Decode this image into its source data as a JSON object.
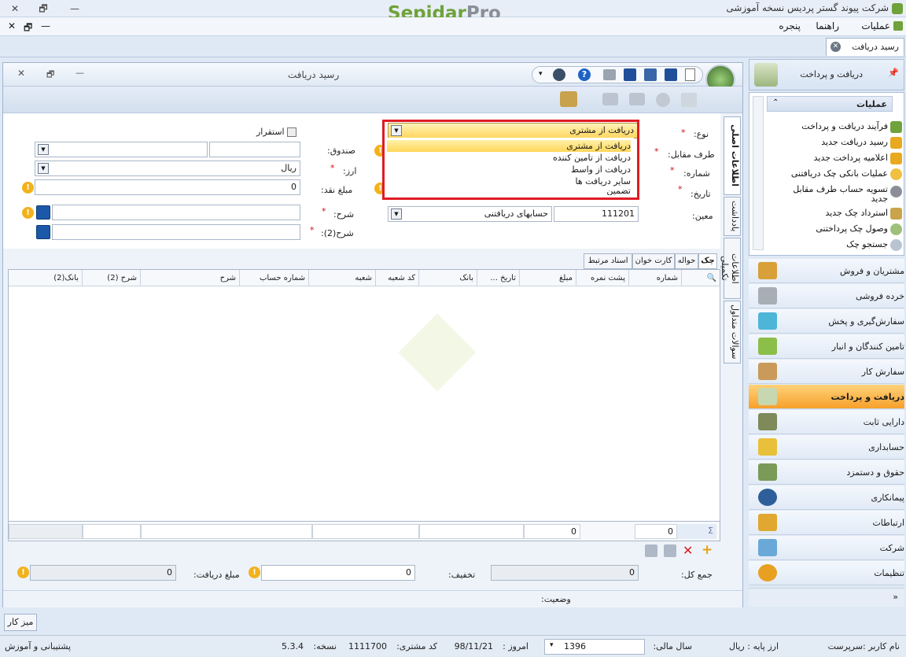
{
  "app": {
    "title": "شرکت پیوند گستر پردیس نسخه آموزشی",
    "logo_main": "Sepidar",
    "logo_accent": "Pro",
    "menu": [
      "عملیات",
      "راهنما",
      "پنجره"
    ]
  },
  "doc_tab": {
    "label": "رسید دریافت"
  },
  "window": {
    "title": "رسید دریافت"
  },
  "form": {
    "type_label": "نوع:",
    "type_value": "دریافت از مشتری",
    "type_options": [
      "دریافت از مشتری",
      "دریافت از تامین کننده",
      "دریافت از واسط",
      "سایر دریافت ها",
      "تضمین"
    ],
    "counterparty_label": "طرف مقابل:",
    "number_label": "شماره:",
    "date_label": "تاریخ:",
    "ledger_label": "معین:",
    "ledger_code": "111201",
    "ledger_name": "حسابهای دریافتنی",
    "settle_label": "استقرار",
    "cashbox_label": "صندوق:",
    "currency_label": "ارز:",
    "currency_value": "ریال",
    "cash_label": "مبلغ نقد:",
    "cash_value": "0",
    "desc_label": "شرح:",
    "desc2_label": "شرح(2):"
  },
  "vtabs": [
    "اطلاعات اصلی",
    "یادداشت",
    "اطلاعات تکمیلی",
    "سوالات متداول"
  ],
  "grid_tabs": [
    "چک",
    "حواله",
    "کارت خوان",
    "اسناد مرتبط"
  ],
  "grid_headers": [
    "شماره",
    "پشت نمره",
    "مبلغ",
    "تاریخ ...",
    "بانک",
    "کد شعبه",
    "شعبه",
    "شماره حساب",
    "شرح",
    "شرح (2)",
    "بانک(2)"
  ],
  "grid_footer": {
    "count": "0",
    "sum": "0"
  },
  "totals": {
    "total_label": "جمع کل:",
    "total_value": "0",
    "discount_label": "تخفیف:",
    "discount_value": "0",
    "received_label": "مبلغ دریافت:",
    "received_value": "0"
  },
  "status": {
    "label": "وضعیت:"
  },
  "right_panel": {
    "title": "دریافت و پرداخت",
    "ops_title": "عملیات",
    "ops": [
      "فرآیند دریافت و پرداخت",
      "رسید دریافت جدید",
      "اعلامیه پرداخت جدید",
      "عملیات بانکی چک دریافتنی",
      "تسویه حساب طرف مقابل",
      "جدید",
      "استرداد چک جدید",
      "وصول چک پرداختنی",
      "جستجو چک"
    ],
    "modules": [
      "مشتریان و فروش",
      "خرده فروشی",
      "سفارش‌گیری و پخش",
      "تامین کنندگان و انبار",
      "سفارش کار",
      "دریافت و پرداخت",
      "دارایی ثابت",
      "حسابداری",
      "حقوق و دستمزد",
      "پیمانکاری",
      "ارتباطات",
      "شرکت",
      "تنظیمات"
    ],
    "active_module": "دریافت و پرداخت"
  },
  "desk": "میز کار",
  "statusbar": {
    "user": "نام کاربر :سرپرست",
    "base_currency": "ارز پایه :  ریال",
    "fiscal_year_label": "سال مالی:",
    "fiscal_year": "1396",
    "today_label": "امروز :",
    "today": "98/11/21",
    "customer_code_label": "کد مشتری:",
    "customer_code": "1111700",
    "version_label": "نسخه:",
    "version": "5.3.4",
    "support": "پشتیبانی و آموزش"
  },
  "colors": {
    "accent_orange": "#f7a02b",
    "highlight_red": "#e01b24",
    "logo_green": "#6fa23a"
  }
}
